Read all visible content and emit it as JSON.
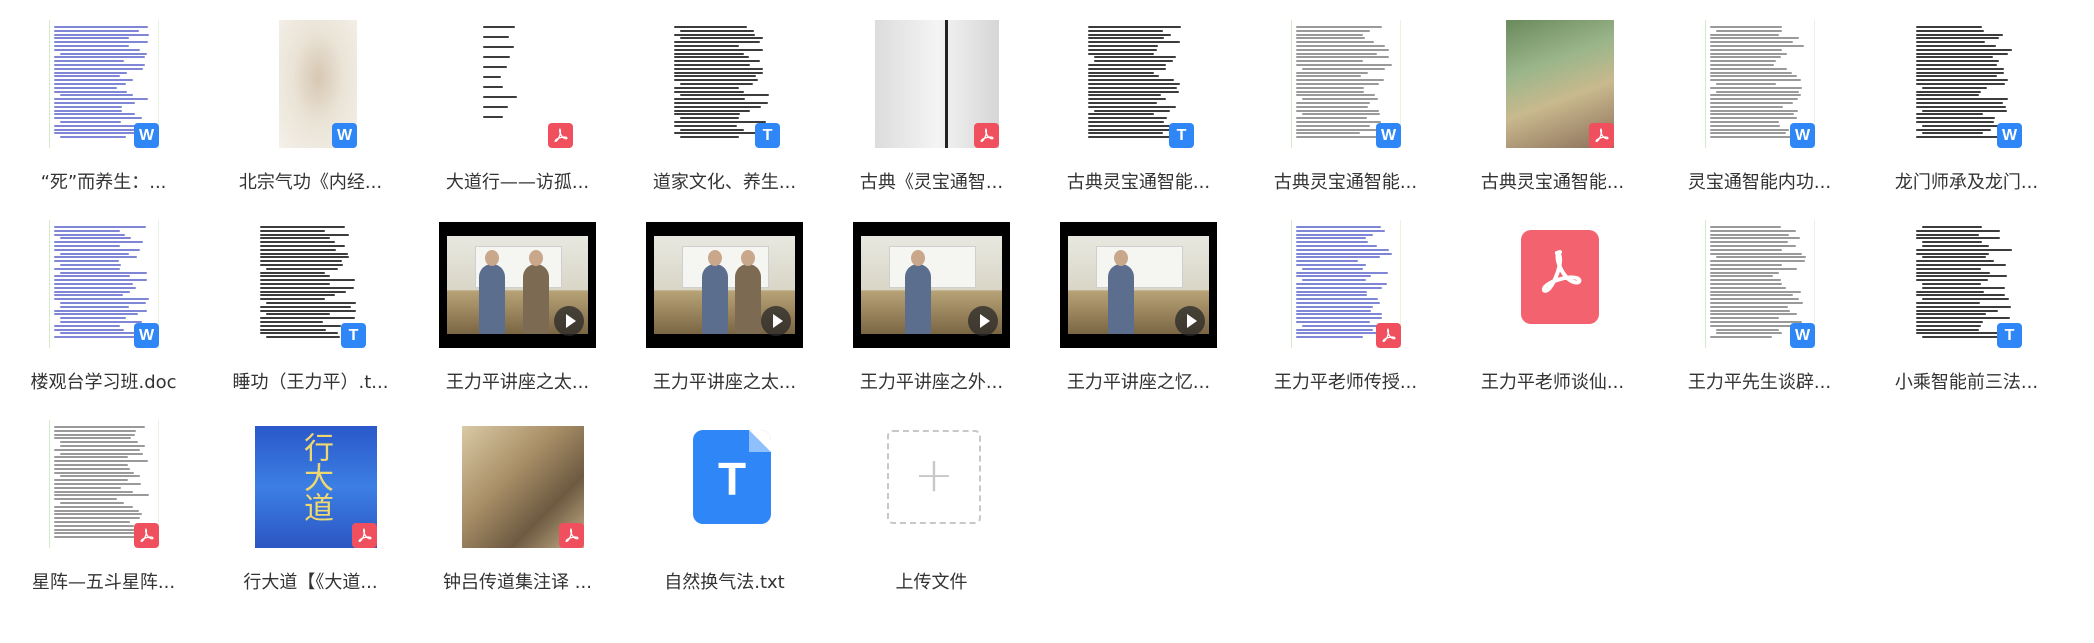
{
  "files": [
    {
      "name": "“死”而养生：...",
      "type": "word",
      "thumb": "doc-blue"
    },
    {
      "name": "北宗气功《内经...",
      "type": "word",
      "thumb": "img-sketch"
    },
    {
      "name": "大道行——访孤...",
      "type": "pdf",
      "thumb": "doc-sparse"
    },
    {
      "name": "道家文化、养生...",
      "type": "txt",
      "thumb": "doc-dark"
    },
    {
      "name": "古典《灵宝通智...",
      "type": "pdf",
      "thumb": "img-scan"
    },
    {
      "name": "古典灵宝通智能...",
      "type": "txt",
      "thumb": "doc-dark"
    },
    {
      "name": "古典灵宝通智能...",
      "type": "word",
      "thumb": "doc-gray"
    },
    {
      "name": "古典灵宝通智能...",
      "type": "pdf",
      "thumb": "img-book"
    },
    {
      "name": "灵宝通智能内功...",
      "type": "word",
      "thumb": "doc-gray"
    },
    {
      "name": "龙门师承及龙门...",
      "type": "word",
      "thumb": "doc-dark"
    },
    {
      "name": "楼观台学习班.doc",
      "type": "word",
      "thumb": "doc-blue"
    },
    {
      "name": "睡功（王力平）.t...",
      "type": "txt",
      "thumb": "doc-dark"
    },
    {
      "name": "王力平讲座之太...",
      "type": "video",
      "thumb": "video"
    },
    {
      "name": "王力平讲座之太...",
      "type": "video",
      "thumb": "video"
    },
    {
      "name": "王力平讲座之外...",
      "type": "video",
      "thumb": "video"
    },
    {
      "name": "王力平讲座之忆...",
      "type": "video",
      "thumb": "video"
    },
    {
      "name": "王力平老师传授...",
      "type": "pdf",
      "thumb": "doc-blue"
    },
    {
      "name": "王力平老师谈仙...",
      "type": "pdf-big",
      "thumb": "icon"
    },
    {
      "name": "王力平先生谈辟...",
      "type": "word",
      "thumb": "doc-gray"
    },
    {
      "name": "小乘智能前三法...",
      "type": "txt",
      "thumb": "doc-dark"
    },
    {
      "name": "星阵—五斗星阵...",
      "type": "pdf",
      "thumb": "doc-gray"
    },
    {
      "name": "行大道【《大道...",
      "type": "pdf",
      "thumb": "img-xing"
    },
    {
      "name": "钟吕传道集注译 ...",
      "type": "pdf",
      "thumb": "img-zhong"
    },
    {
      "name": "自然换气法.txt",
      "type": "txt-big",
      "thumb": "icon"
    }
  ],
  "upload": {
    "label": "上传文件"
  },
  "colors": {
    "word": "#2f86f6",
    "pdf": "#f0505e",
    "txt": "#2f86f6",
    "text": "#333333"
  }
}
